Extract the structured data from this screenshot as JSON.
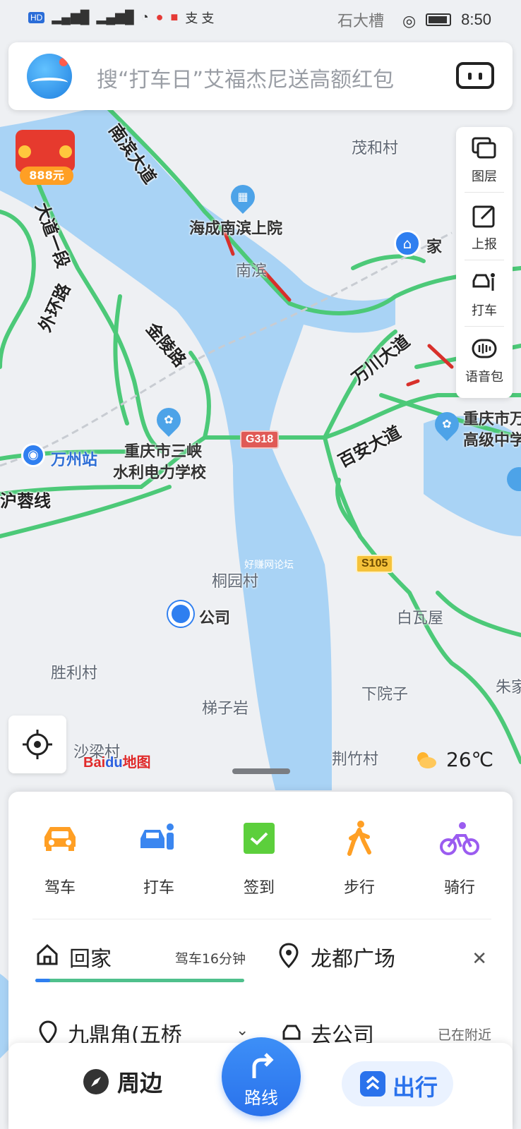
{
  "status_bar": {
    "left_text": "HD",
    "carrier_text": "支 支",
    "location_label": "石大槽",
    "time": "8:50"
  },
  "search": {
    "placeholder": "搜“打车日”艾福杰尼送高额红包",
    "logo_icon": "baidu-map-logo-icon",
    "camera_icon": "ar-scan-icon"
  },
  "red_packet": {
    "amount": "888元"
  },
  "tools": [
    {
      "label": "图层",
      "icon": "layers-icon"
    },
    {
      "label": "上报",
      "icon": "report-edit-icon"
    },
    {
      "label": "打车",
      "icon": "taxi-icon"
    },
    {
      "label": "语音包",
      "icon": "voice-pack-icon"
    }
  ],
  "map": {
    "place_labels": {
      "maohecun": "茂和村",
      "haicheng": "海成南滨上院",
      "nanbin": "南滨",
      "home": "家",
      "wanzhou_station": "万州站",
      "sanxia_school_1": "重庆市三峡",
      "sanxia_school_2": "水利电力学校",
      "chongqing_school_1": "重庆市万",
      "chongqing_school_2": "高级中学",
      "tongyuancun": "桐园村",
      "company": "公司",
      "baiwawu": "白瓦屋",
      "shenglicun": "胜利村",
      "xiayuanzi": "下院子",
      "zhujia": "朱家",
      "tiziyan": "梯子岩",
      "shaliangcun": "沙梁村",
      "jingzhucun": "荆竹村",
      "watermark": "好赚网论坛"
    },
    "road_labels": {
      "nanbin_dadao": "南滨大道",
      "dadao_yiduan": "大道一段",
      "waihuan_lu": "外环路",
      "jinling_lu": "金陵路",
      "wanchuan_dadao": "万川大道",
      "baian_dadao": "百安大道",
      "hurong_xian": "沪蓉线"
    },
    "shields": {
      "g318": "G318",
      "s105": "S105"
    },
    "colors": {
      "water": "#a9d3f5",
      "road_green": "#4cc978",
      "road_red": "#d8302b",
      "land": "#eef0f3"
    }
  },
  "map_controls": {
    "locate_icon": "locate-crosshair-icon",
    "logo_text_a": "Bai",
    "logo_text_b": "du",
    "logo_text_c": "地图",
    "weather_icon": "partly-cloudy-icon",
    "temperature": "26℃"
  },
  "modes": [
    {
      "label": "驾车",
      "icon": "car-icon",
      "color": "#ff9f24"
    },
    {
      "label": "打车",
      "icon": "taxi-icon",
      "color": "#3a86f0"
    },
    {
      "label": "签到",
      "icon": "checkin-icon",
      "color": "#5ccf3c"
    },
    {
      "label": "步行",
      "icon": "walk-icon",
      "color": "#ff9f24"
    },
    {
      "label": "骑行",
      "icon": "bike-icon",
      "color": "#9b5cf0"
    }
  ],
  "favorites": {
    "home_label": "回家",
    "home_meta": "驾车16分钟",
    "home_progress": 0.07,
    "dest_label": "龙都广场"
  },
  "route_row": {
    "a": "九鼎角(五桥",
    "b": "去公司",
    "c": "已在附近"
  },
  "bottom_nav": {
    "nearby": "周边",
    "route": "路线",
    "travel": "出行"
  }
}
